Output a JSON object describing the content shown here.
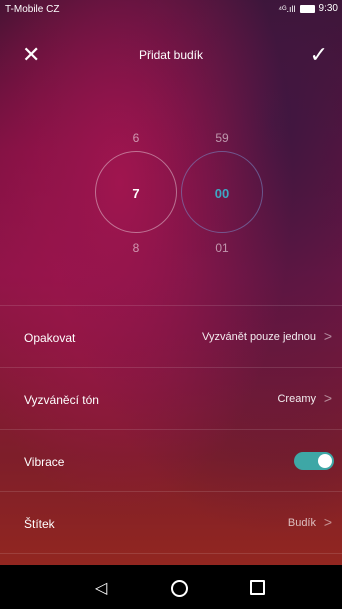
{
  "status_bar": {
    "carrier": "T-Mobile CZ",
    "signal": "⁴ᴳ.ıll",
    "time": "9:30"
  },
  "header": {
    "title": "Přidat budík",
    "close_icon": "close-icon",
    "confirm_icon": "check-icon"
  },
  "time_picker": {
    "hour": {
      "above": "6",
      "selected": "7",
      "below": "8"
    },
    "minute": {
      "above": "59",
      "selected": "00",
      "below": "01"
    },
    "accent": "#3ea7c4"
  },
  "settings": {
    "repeat": {
      "label": "Opakovat",
      "value": "Vyzvánět pouze jednou"
    },
    "ringtone": {
      "label": "Vyzváněcí tón",
      "value": "Creamy"
    },
    "vibrate": {
      "label": "Vibrace",
      "on": true
    },
    "tag": {
      "label": "Štítek",
      "value": "Budík"
    }
  },
  "colors": {
    "toggle_on": "#3ea7a6",
    "minute_selected": "#3ea7c4"
  }
}
